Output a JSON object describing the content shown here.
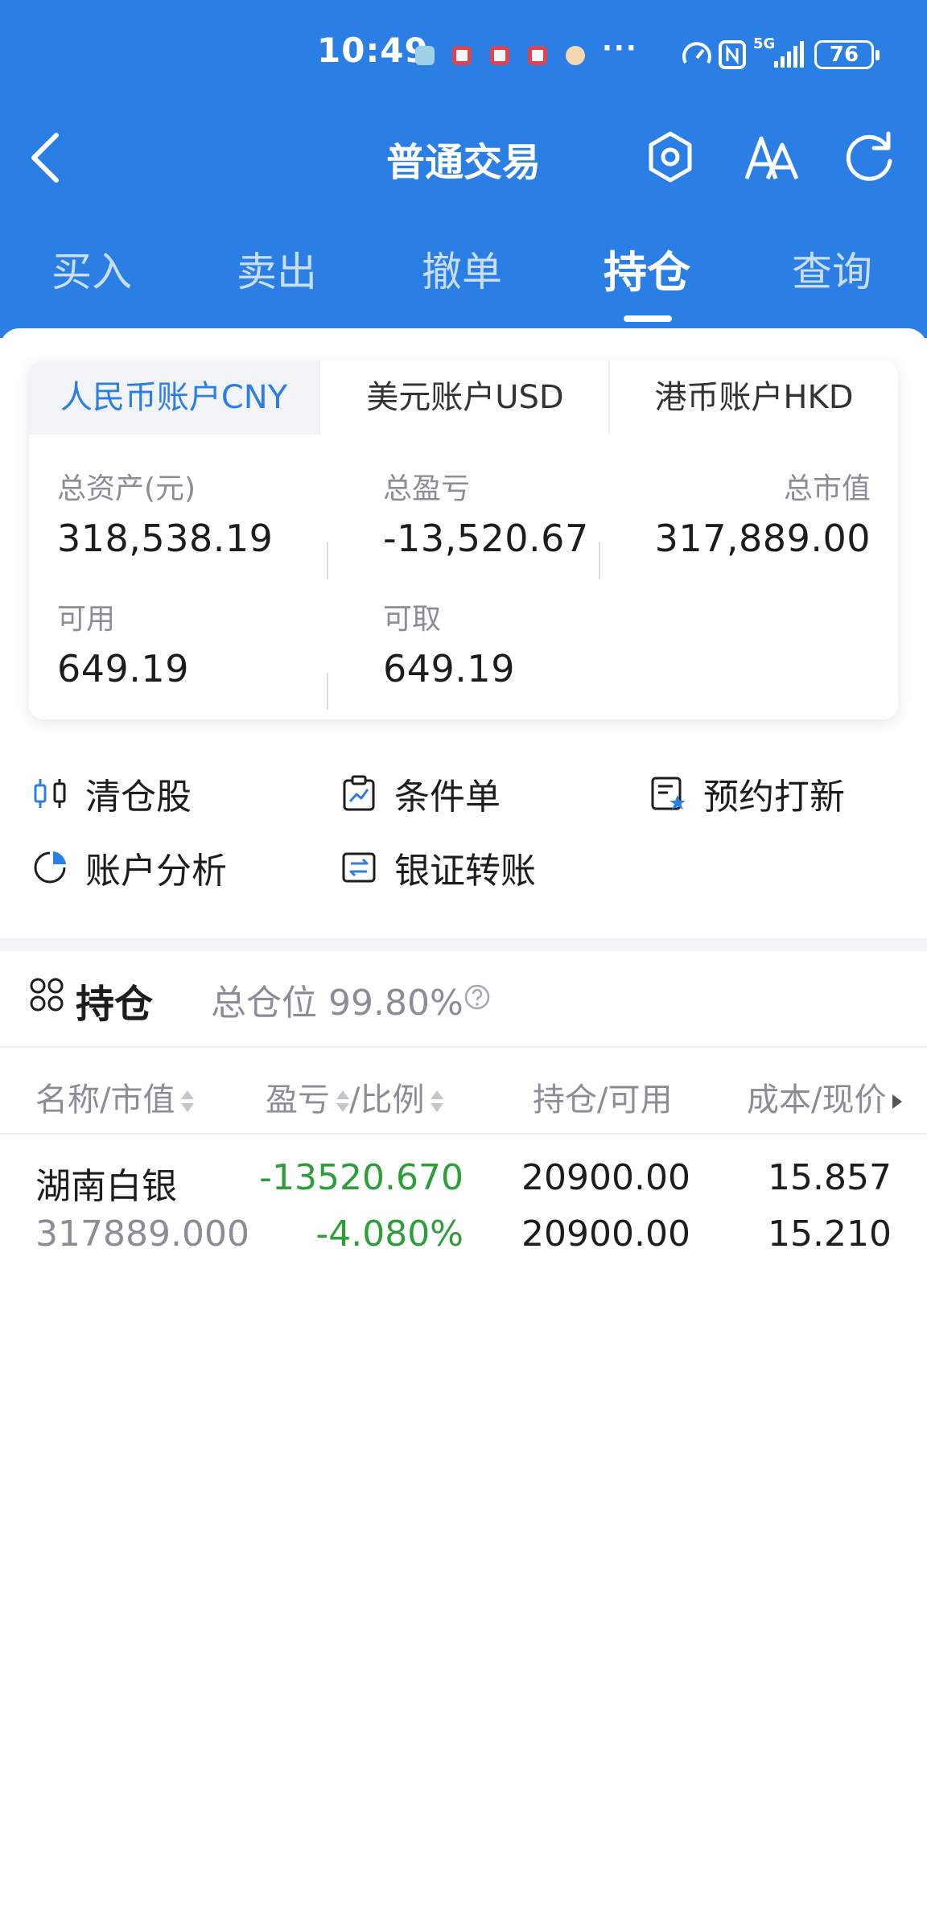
{
  "status_bar": {
    "time": "10:49",
    "more": "···",
    "battery": "76",
    "network": "5G"
  },
  "nav": {
    "title": "普通交易",
    "icons": [
      "back-icon",
      "settings-hexagon-icon",
      "font-size-icon",
      "refresh-icon"
    ]
  },
  "tabs": [
    "买入",
    "卖出",
    "撤单",
    "持仓",
    "查询"
  ],
  "active_tab": "持仓",
  "account_tabs": [
    "人民币账户CNY",
    "美元账户USD",
    "港币账户HKD"
  ],
  "summary": {
    "total_assets_label": "总资产(元)",
    "total_assets": "318,538.19",
    "total_pnl_label": "总盈亏",
    "total_pnl": "-13,520.67",
    "market_value_label": "总市值",
    "market_value": "317,889.00",
    "available_label": "可用",
    "available": "649.19",
    "withdrawable_label": "可取",
    "withdrawable": "649.19"
  },
  "shortcuts": {
    "clear": "清仓股",
    "conditional": "条件单",
    "ipo": "预约打新",
    "analysis": "账户分析",
    "transfer": "银证转账"
  },
  "holdings_header": {
    "title": "持仓",
    "position": "总仓位 99.80%"
  },
  "table": {
    "col_name": "名称/市值",
    "col_pnl": "盈亏",
    "col_ratio": "/比例",
    "col_hold": "持仓/可用",
    "col_cost": "成本/现价"
  },
  "rows": [
    {
      "name": "湖南白银",
      "market_value": "317889.000",
      "pnl": "-13520.670",
      "ratio": "-4.080%",
      "holding": "20900.00",
      "available": "20900.00",
      "cost": "15.857",
      "price": "15.210"
    }
  ],
  "colors": {
    "brand_blue": "#2b7ee3",
    "loss_green": "#2f9e3a"
  }
}
